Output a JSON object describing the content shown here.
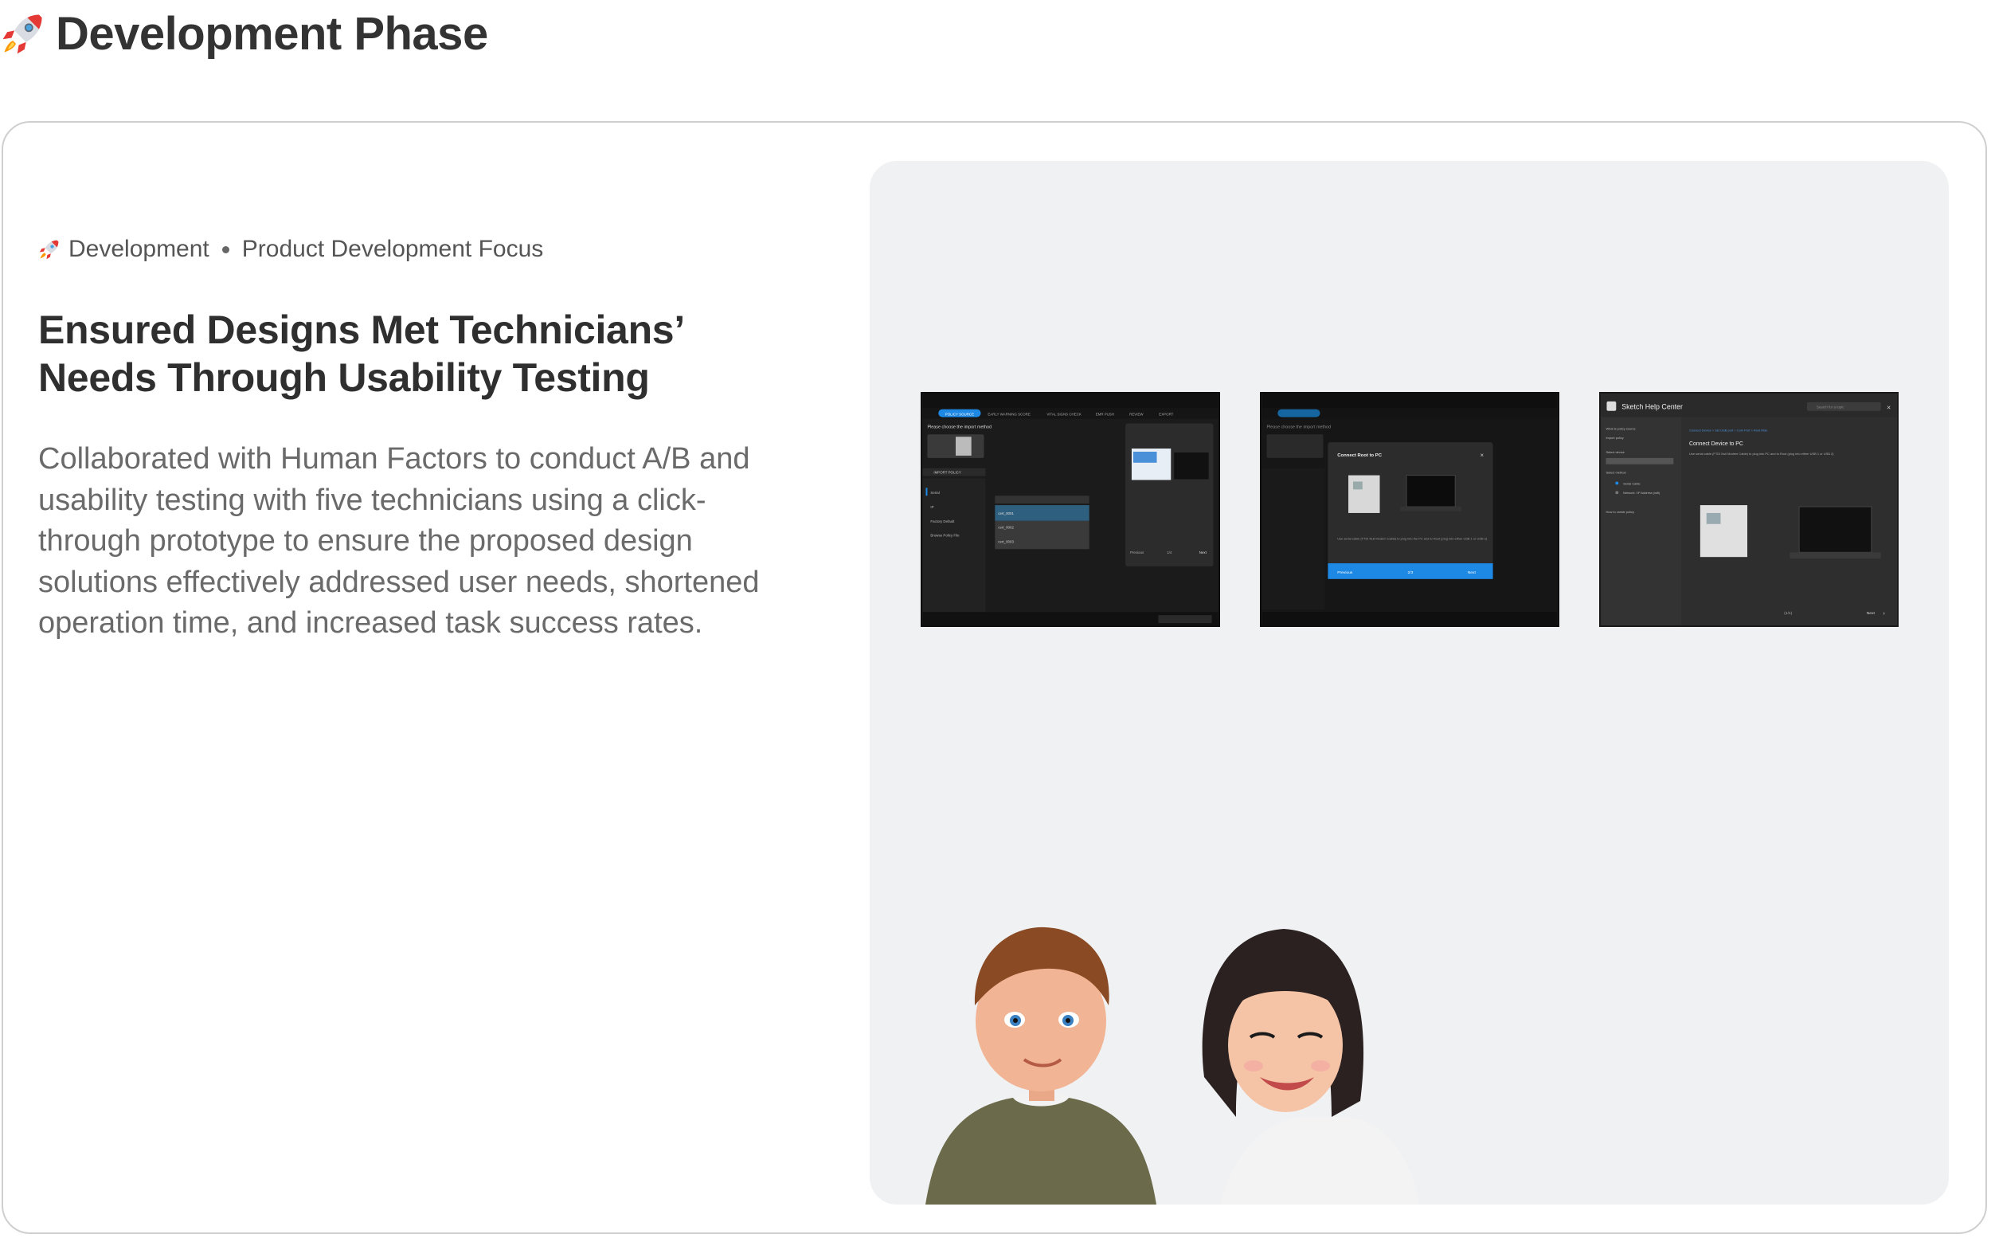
{
  "page": {
    "title": "Development Phase",
    "title_icon": "rocket-icon"
  },
  "card": {
    "eyebrow": {
      "icon": "rocket-icon",
      "label": "Development",
      "focus": "Product Development Focus"
    },
    "headline_line1": "Ensured Designs Met Technicians’",
    "headline_line2": "Needs Through Usability Testing",
    "body": "Collaborated with Human Factors to conduct A/B and usability testing with five technicians using a click-through prototype to ensure the proposed design solutions effectively addressed user needs, shortened operation time, and increased task success rates."
  },
  "screenshots": {
    "shot1": {
      "tabs": [
        "POLICY SOURCE",
        "EARLY WARNING SCORE",
        "VITAL SIGNS CHECK",
        "EMR PUSH",
        "REVIEW",
        "EXPORT"
      ],
      "prompt": "Please choose the import method",
      "section": "IMPORT POLICY",
      "list": [
        "Serial",
        "IP",
        "Factory Default",
        "Browse Policy File"
      ],
      "options": [
        "cert_0001",
        "cert_0002",
        "cert_0003"
      ],
      "pager": "Previous",
      "pager_count": "1/4",
      "next": "Next"
    },
    "shot2": {
      "prompt": "Please choose the import method",
      "dialog_title": "Connect Root to PC",
      "dialog_body": "Use serial cable (FTDI Null Modem Cable) to plug into the PC and to Root (plug into either USB 1 or USB 2)",
      "previous": "Previous",
      "count": "2/3",
      "next": "Next"
    },
    "shot3": {
      "title": "Sketch Help Center",
      "search_placeholder": "Search for a topic",
      "nav": [
        "What is policy source",
        "Import policy",
        "Select device",
        "Select method",
        "Serial Cable",
        "Network / IP Address (wifi)",
        "How to create policy"
      ],
      "breadcrumb": "Connect Device > Set USB port > Com Port > Root Ride",
      "heading": "Connect Device to PC",
      "text": "Use serial cable (FTDI Null Modem Cable) to plug into PC and to Root (plug into either USB 1 or USB 2)",
      "count": "(1/1)",
      "next": "Next"
    }
  },
  "colors": {
    "accent_blue": "#1e88e5",
    "panel_bg": "#f0f1f3",
    "text_dark": "#333333",
    "text_muted": "#6a6a6a"
  }
}
